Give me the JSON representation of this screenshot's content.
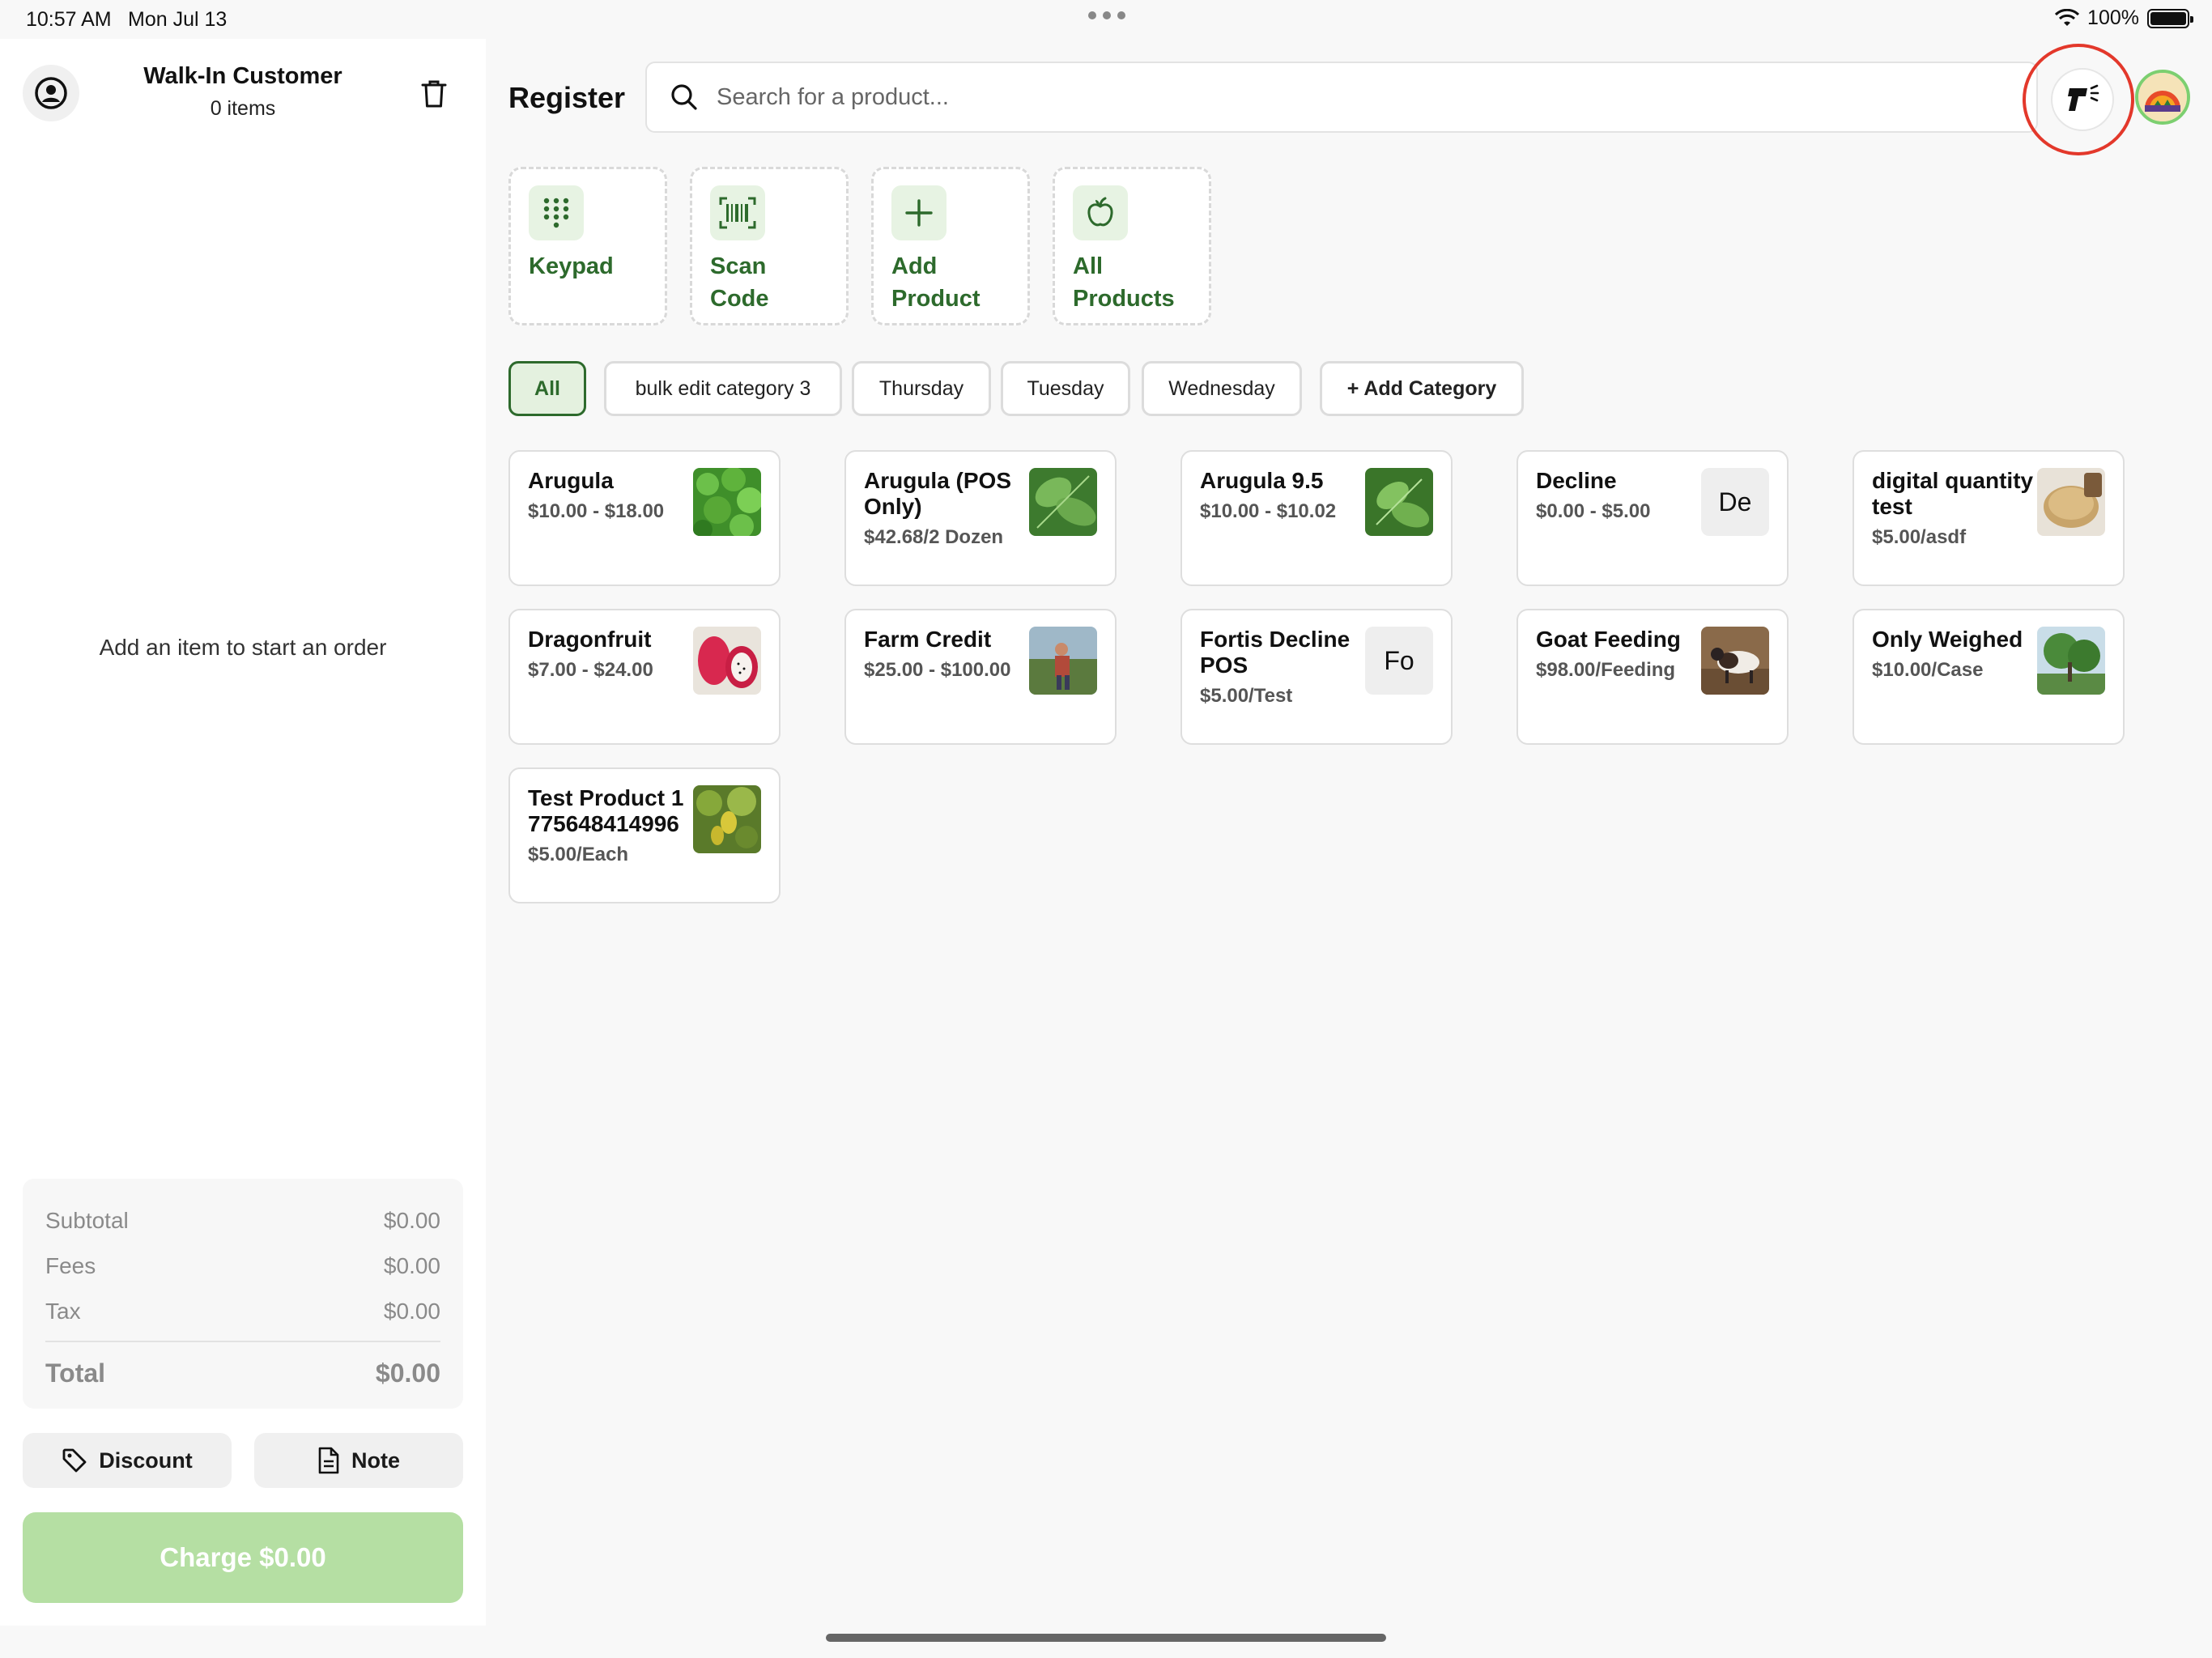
{
  "status": {
    "time": "10:57 AM",
    "date": "Mon Jul 13",
    "battery": "100%"
  },
  "cart": {
    "customer_name": "Walk-In Customer",
    "item_count": "0 items",
    "empty_message": "Add an item to start an order",
    "totals": {
      "subtotal_label": "Subtotal",
      "subtotal": "$0.00",
      "fees_label": "Fees",
      "fees": "$0.00",
      "tax_label": "Tax",
      "tax": "$0.00",
      "total_label": "Total",
      "total": "$0.00"
    },
    "discount_label": "Discount",
    "note_label": "Note",
    "charge_label": "Charge $0.00"
  },
  "header": {
    "title": "Register",
    "search_placeholder": "Search for a product..."
  },
  "quick_actions": [
    {
      "line1": "Keypad",
      "line2": ""
    },
    {
      "line1": "Scan",
      "line2": "Code"
    },
    {
      "line1": "Add",
      "line2": "Product"
    },
    {
      "line1": "All",
      "line2": "Products"
    }
  ],
  "categories": [
    "All",
    "bulk edit category 3",
    "Thursday",
    "Tuesday",
    "Wednesday",
    "+ Add Category"
  ],
  "products": [
    {
      "name": "Arugula",
      "price": "$10.00 - $18.00"
    },
    {
      "name": "Arugula (POS Only)",
      "price": "$42.68/2 Dozen"
    },
    {
      "name": "Arugula 9.5",
      "price": "$10.00 - $10.02"
    },
    {
      "name": "Decline",
      "price": "$0.00 - $5.00",
      "initials": "De"
    },
    {
      "name": "digital quantity test",
      "price": "$5.00/asdf"
    },
    {
      "name": "Dragonfruit",
      "price": "$7.00 - $24.00"
    },
    {
      "name": "Farm Credit",
      "price": "$25.00 - $100.00"
    },
    {
      "name": "Fortis Decline POS",
      "price": "$5.00/Test",
      "initials": "Fo"
    },
    {
      "name": "Goat Feeding",
      "price": "$98.00/Feeding"
    },
    {
      "name": "Only Weighed",
      "price": "$10.00/Case"
    },
    {
      "name": "Test Product 1775648414996",
      "price": "$5.00/Each"
    }
  ],
  "colors": {
    "accent": "#2d6a2c",
    "charge": "#b5dfa3",
    "highlight": "#e3382b"
  }
}
